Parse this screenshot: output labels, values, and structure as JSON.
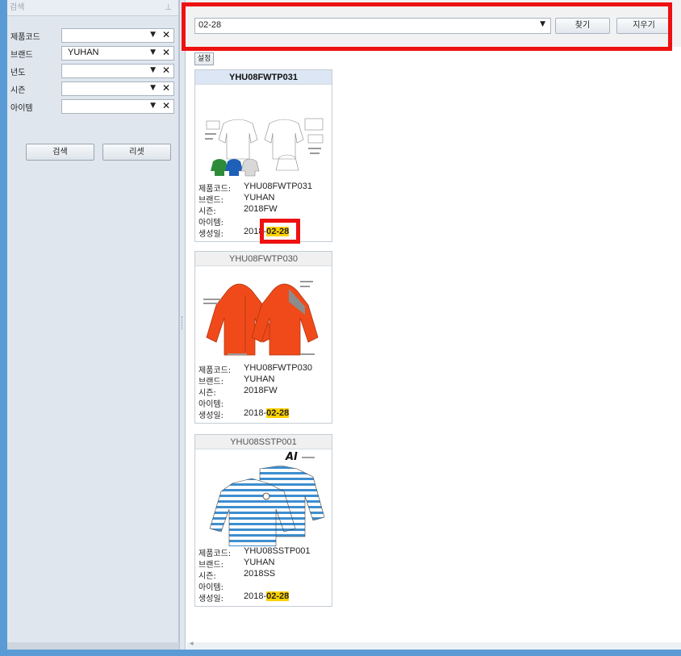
{
  "left_panel": {
    "header": "검색",
    "pin_icon": "⊥",
    "fields": [
      {
        "label": "제품코드",
        "value": ""
      },
      {
        "label": "브랜드",
        "value": "YUHAN"
      },
      {
        "label": "년도",
        "value": ""
      },
      {
        "label": "시즌",
        "value": ""
      },
      {
        "label": "아이템",
        "value": ""
      }
    ],
    "dropdown_glyph": "▼",
    "clear_glyph": "✕",
    "search_button": "검색",
    "reset_button": "리셋"
  },
  "topbar": {
    "search_value": "02-28",
    "find_button": "찾기",
    "clear_button": "지우기"
  },
  "settings_button": "설정",
  "labels": {
    "code": "제품코드:",
    "brand": "브랜드:",
    "season": "시즌:",
    "item": "아이템:",
    "created": "생성일:"
  },
  "cards": [
    {
      "title": "YHU08FWTP031",
      "code": "YHU08FWTP031",
      "brand": "YUHAN",
      "season": "2018FW",
      "item": "",
      "date_prefix": "2018-",
      "date_hl": "02-28"
    },
    {
      "title": "YHU08FWTP030",
      "code": "YHU08FWTP030",
      "brand": "YUHAN",
      "season": "2018FW",
      "item": "",
      "date_prefix": "2018-",
      "date_hl": "02-28"
    },
    {
      "title": "YHU08SSTP001",
      "code": "YHU08SSTP001",
      "brand": "YUHAN",
      "season": "2018SS",
      "item": "",
      "date_prefix": "2018-",
      "date_hl": "02-28",
      "img_text": "AI"
    }
  ],
  "colors": {
    "highlight_border": "#ee1111",
    "match_highlight": "#ffd200",
    "frame": "#5b9bd5",
    "jacket_orange": "#f04a1a",
    "stripe_blue": "#3d8ed0"
  }
}
